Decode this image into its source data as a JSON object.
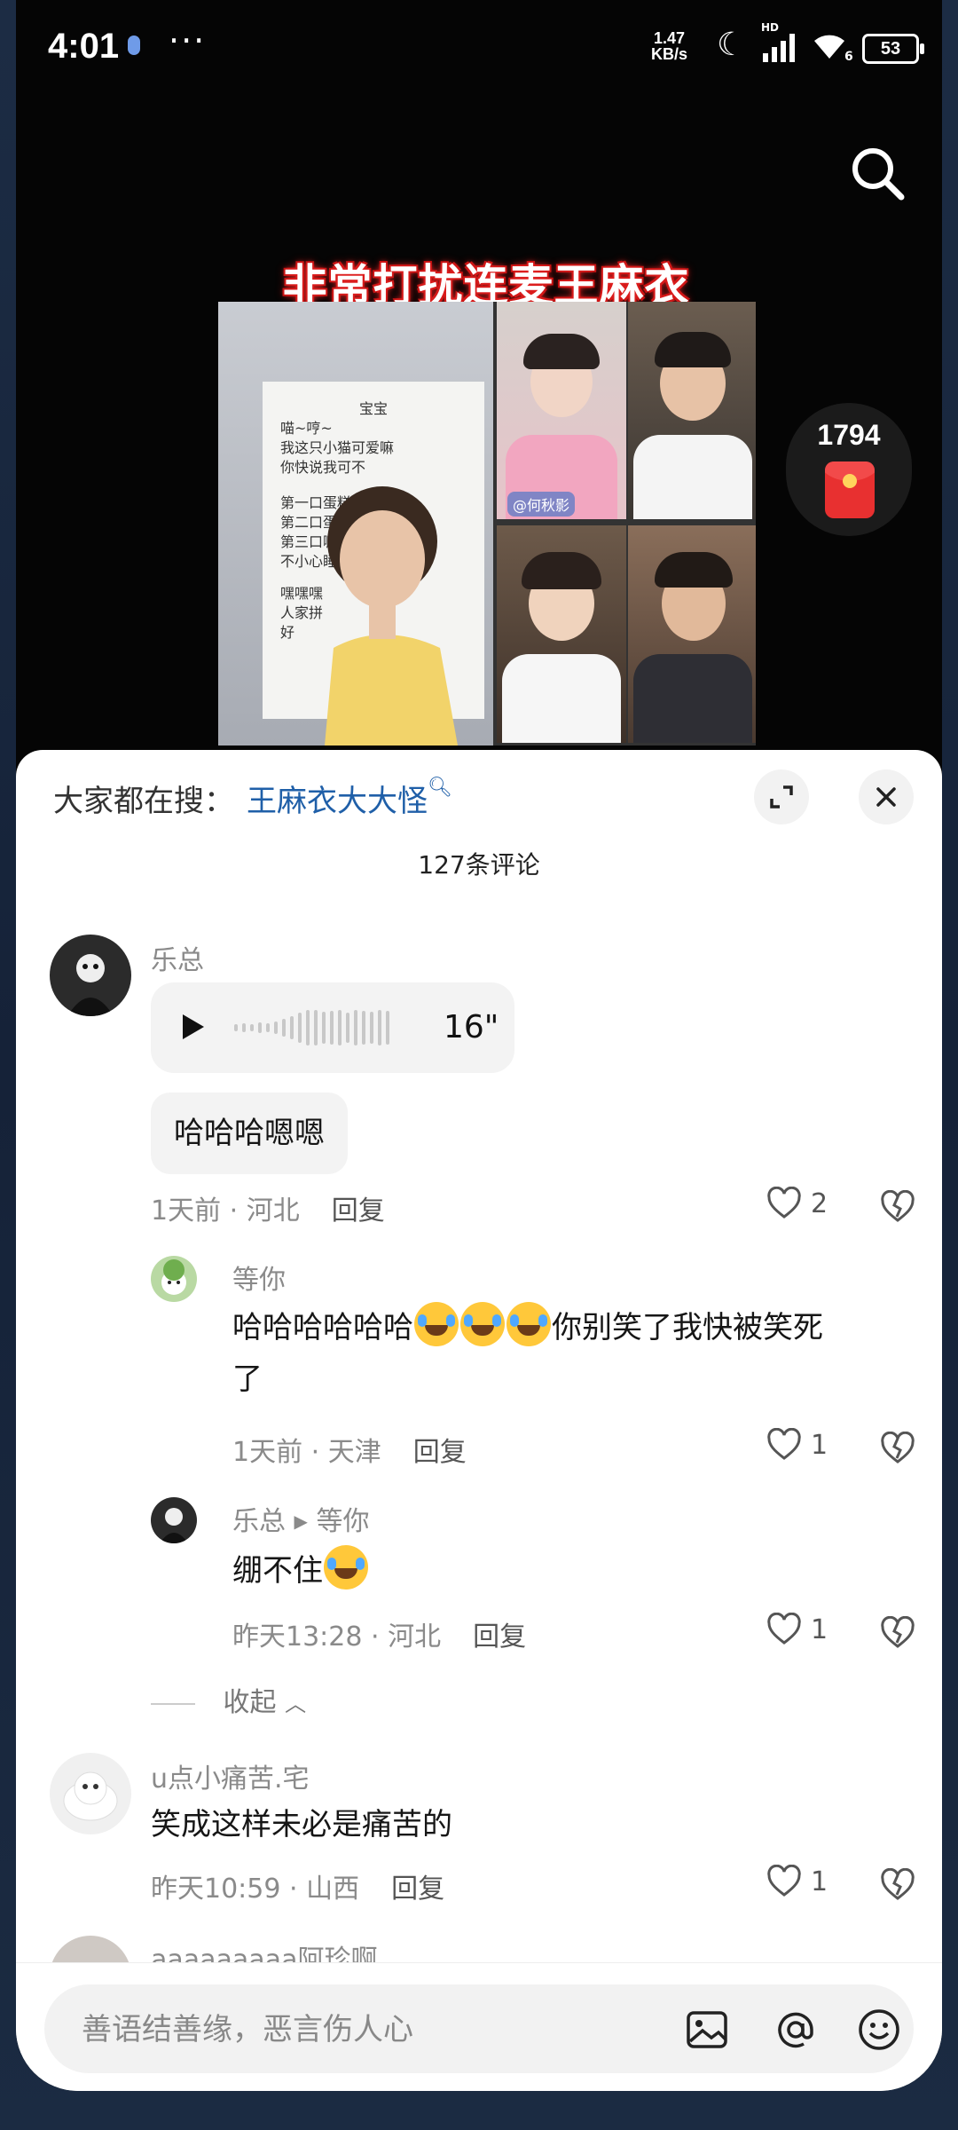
{
  "status_bar": {
    "time": "4:01",
    "dots": "···",
    "net_speed_value": "1.47",
    "net_speed_unit": "KB/s",
    "hd": "HD",
    "wifi_gen": "6",
    "battery": "53"
  },
  "video": {
    "title": "非常打扰连麦王麻衣",
    "paper_lines": [
      "宝宝",
      "喵~哼~",
      "我这只小猫可爱嘛",
      "你快说我可不",
      "第一口蛋糕要你",
      "第二口蛋糕要你",
      "第三口嘛",
      "不小心睡在鼻尖上",
      "嘿嘿嘿",
      "人家拼",
      "好"
    ],
    "tile_label": "@何秋影",
    "red_packet_count": "1794"
  },
  "comments_panel": {
    "hot_search_label": "大家都在搜：",
    "hot_search_keyword": "王麻衣大大怪",
    "comment_count": "127条评论",
    "comments": [
      {
        "user": "乐总",
        "voice_duration": "16\"",
        "text": "哈哈哈嗯嗯",
        "time": "1天前",
        "location": "河北",
        "reply_label": "回复",
        "likes": "2"
      },
      {
        "user": "等你",
        "text_prefix": "哈哈哈哈哈哈",
        "text_suffix": "你别笑了我快被笑死",
        "text_line2": "了",
        "time": "1天前",
        "location": "天津",
        "reply_label": "回复",
        "likes": "1"
      },
      {
        "user": "乐总",
        "reply_to": "等你",
        "text": "绷不住",
        "time": "昨天13:28",
        "location": "河北",
        "reply_label": "回复",
        "likes": "1"
      },
      {
        "user": "u点小痛苦.宅",
        "text": "笑成这样未必是痛苦的",
        "time": "昨天10:59",
        "location": "山西",
        "reply_label": "回复",
        "likes": "1"
      },
      {
        "user": "aaaaaaaaa阿珍啊"
      }
    ],
    "collapse_label": "收起",
    "input_placeholder": "善语结善缘，恶言伤人心"
  }
}
